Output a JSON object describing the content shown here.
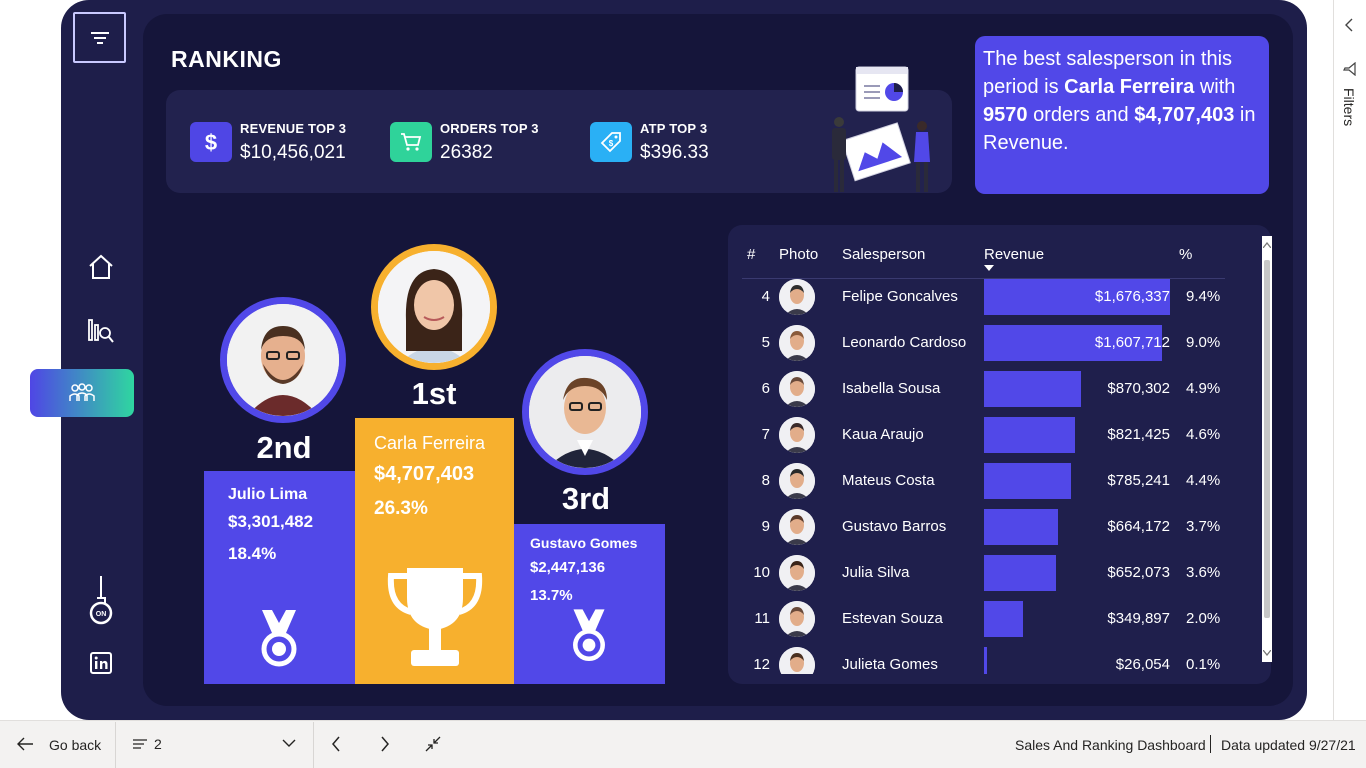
{
  "page": {
    "title": "RANKING",
    "nav": {
      "filter_icon": "filter-lines-icon",
      "home_icon": "home-icon",
      "analysis_icon": "bar-search-icon",
      "team_icon": "team-icon",
      "toggle_icon": "lightbulb-toggle-icon",
      "linkedin_icon": "linkedin-icon"
    },
    "kpis": [
      {
        "label": "REVENUE TOP 3",
        "value": "$10,456,021",
        "icon": "dollar-icon",
        "color": "#4f46e5"
      },
      {
        "label": "ORDERS TOP 3",
        "value": "26382",
        "icon": "cart-icon",
        "color": "#2fd39a"
      },
      {
        "label": "ATP TOP 3",
        "value": "$396.33",
        "icon": "price-tag-icon",
        "color": "#2ab0f5"
      }
    ],
    "callout": {
      "prefix": "The best salesperson in this period is",
      "name": "Carla Ferreira",
      "with": "with",
      "orders": "9570",
      "orders_word": "orders and",
      "revenue": "$4,707,403",
      "suffix": "in Revenue."
    },
    "podium": {
      "first": {
        "place": "1st",
        "name": "Carla Ferreira",
        "revenue": "$4,707,403",
        "pct": "26.3%",
        "color": "#f7b02e",
        "icon": "trophy-icon"
      },
      "second": {
        "place": "2nd",
        "name": "Julio Lima",
        "revenue": "$3,301,482",
        "pct": "18.4%",
        "color": "#5148e8",
        "icon": "medal-icon"
      },
      "third": {
        "place": "3rd",
        "name": "Gustavo Gomes",
        "revenue": "$2,447,136",
        "pct": "13.7%",
        "color": "#5148e8",
        "icon": "medal-icon"
      }
    },
    "table": {
      "headers": {
        "num": "#",
        "photo": "Photo",
        "salesperson": "Salesperson",
        "revenue": "Revenue",
        "pct": "%"
      },
      "sort_icon": "sort-down-icon",
      "max_revenue": 1676337,
      "rows": [
        {
          "num": "4",
          "name": "Felipe Goncalves",
          "revenue": "$1,676,337",
          "value": 1676337,
          "pct": "9.4%"
        },
        {
          "num": "5",
          "name": "Leonardo Cardoso",
          "revenue": "$1,607,712",
          "value": 1607712,
          "pct": "9.0%"
        },
        {
          "num": "6",
          "name": "Isabella Sousa",
          "revenue": "$870,302",
          "value": 870302,
          "pct": "4.9%"
        },
        {
          "num": "7",
          "name": "Kaua Araujo",
          "revenue": "$821,425",
          "value": 821425,
          "pct": "4.6%"
        },
        {
          "num": "8",
          "name": "Mateus Costa",
          "revenue": "$785,241",
          "value": 785241,
          "pct": "4.4%"
        },
        {
          "num": "9",
          "name": "Gustavo Barros",
          "revenue": "$664,172",
          "value": 664172,
          "pct": "3.7%"
        },
        {
          "num": "10",
          "name": "Julia Silva",
          "revenue": "$652,073",
          "value": 652073,
          "pct": "3.6%"
        },
        {
          "num": "11",
          "name": "Estevan Souza",
          "revenue": "$349,897",
          "value": 349897,
          "pct": "2.0%"
        },
        {
          "num": "12",
          "name": "Julieta Gomes",
          "revenue": "$26,054",
          "value": 26054,
          "pct": "0.1%"
        }
      ]
    }
  },
  "bottom_bar": {
    "go_back": "Go back",
    "page_selector": "2",
    "report_name": "Sales And Ranking Dashboard",
    "data_updated": "Data updated 9/27/21"
  },
  "right_pane": {
    "filters": "Filters"
  },
  "colors": {
    "bg": "#1e1e4a",
    "canvas": "#15153a",
    "accent": "#5148e8",
    "gold": "#f7b02e"
  }
}
